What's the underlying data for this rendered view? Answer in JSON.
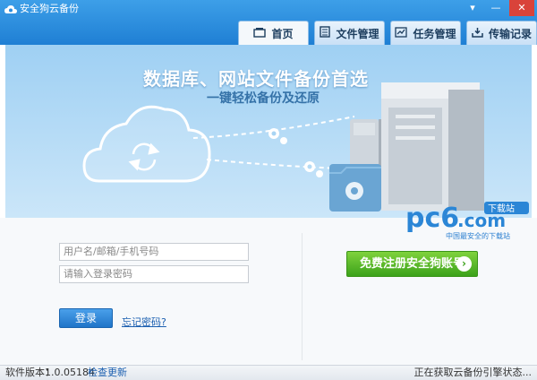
{
  "window": {
    "title": "安全狗云备份",
    "controls": [
      "▾",
      "—",
      "✕"
    ],
    "icon": "cloud-logo-icon"
  },
  "tabs": [
    {
      "label": "首页",
      "icon": "home-icon"
    },
    {
      "label": "文件管理",
      "icon": "file-manage-icon"
    },
    {
      "label": "任务管理",
      "icon": "task-icon"
    },
    {
      "label": "传输记录",
      "icon": "transfer-icon"
    }
  ],
  "banner": {
    "title": "数据库、网站文件备份首选",
    "subtitle": "一键轻松备份及还原"
  },
  "login": {
    "username_placeholder": "用户名/邮箱/手机号码",
    "password_placeholder": "请输入登录密码",
    "login_button": "登录",
    "forgot_link": "忘记密码?"
  },
  "register": {
    "button_label": "免费注册安全狗账号",
    "arrow": "›"
  },
  "watermark": {
    "brand": "pc6",
    "domain": ".com",
    "badge": "下载站",
    "slogan": "中国最安全的下载站"
  },
  "status": {
    "version_label": "软件版本：",
    "version_value": "1.0.05184",
    "check_update": "检查更新",
    "status_text": "正在获取云备份引擎状态..."
  },
  "colors": {
    "titlebar": "#2a8ee0",
    "register_green": "#4cb224",
    "login_blue": "#2f86d9"
  }
}
